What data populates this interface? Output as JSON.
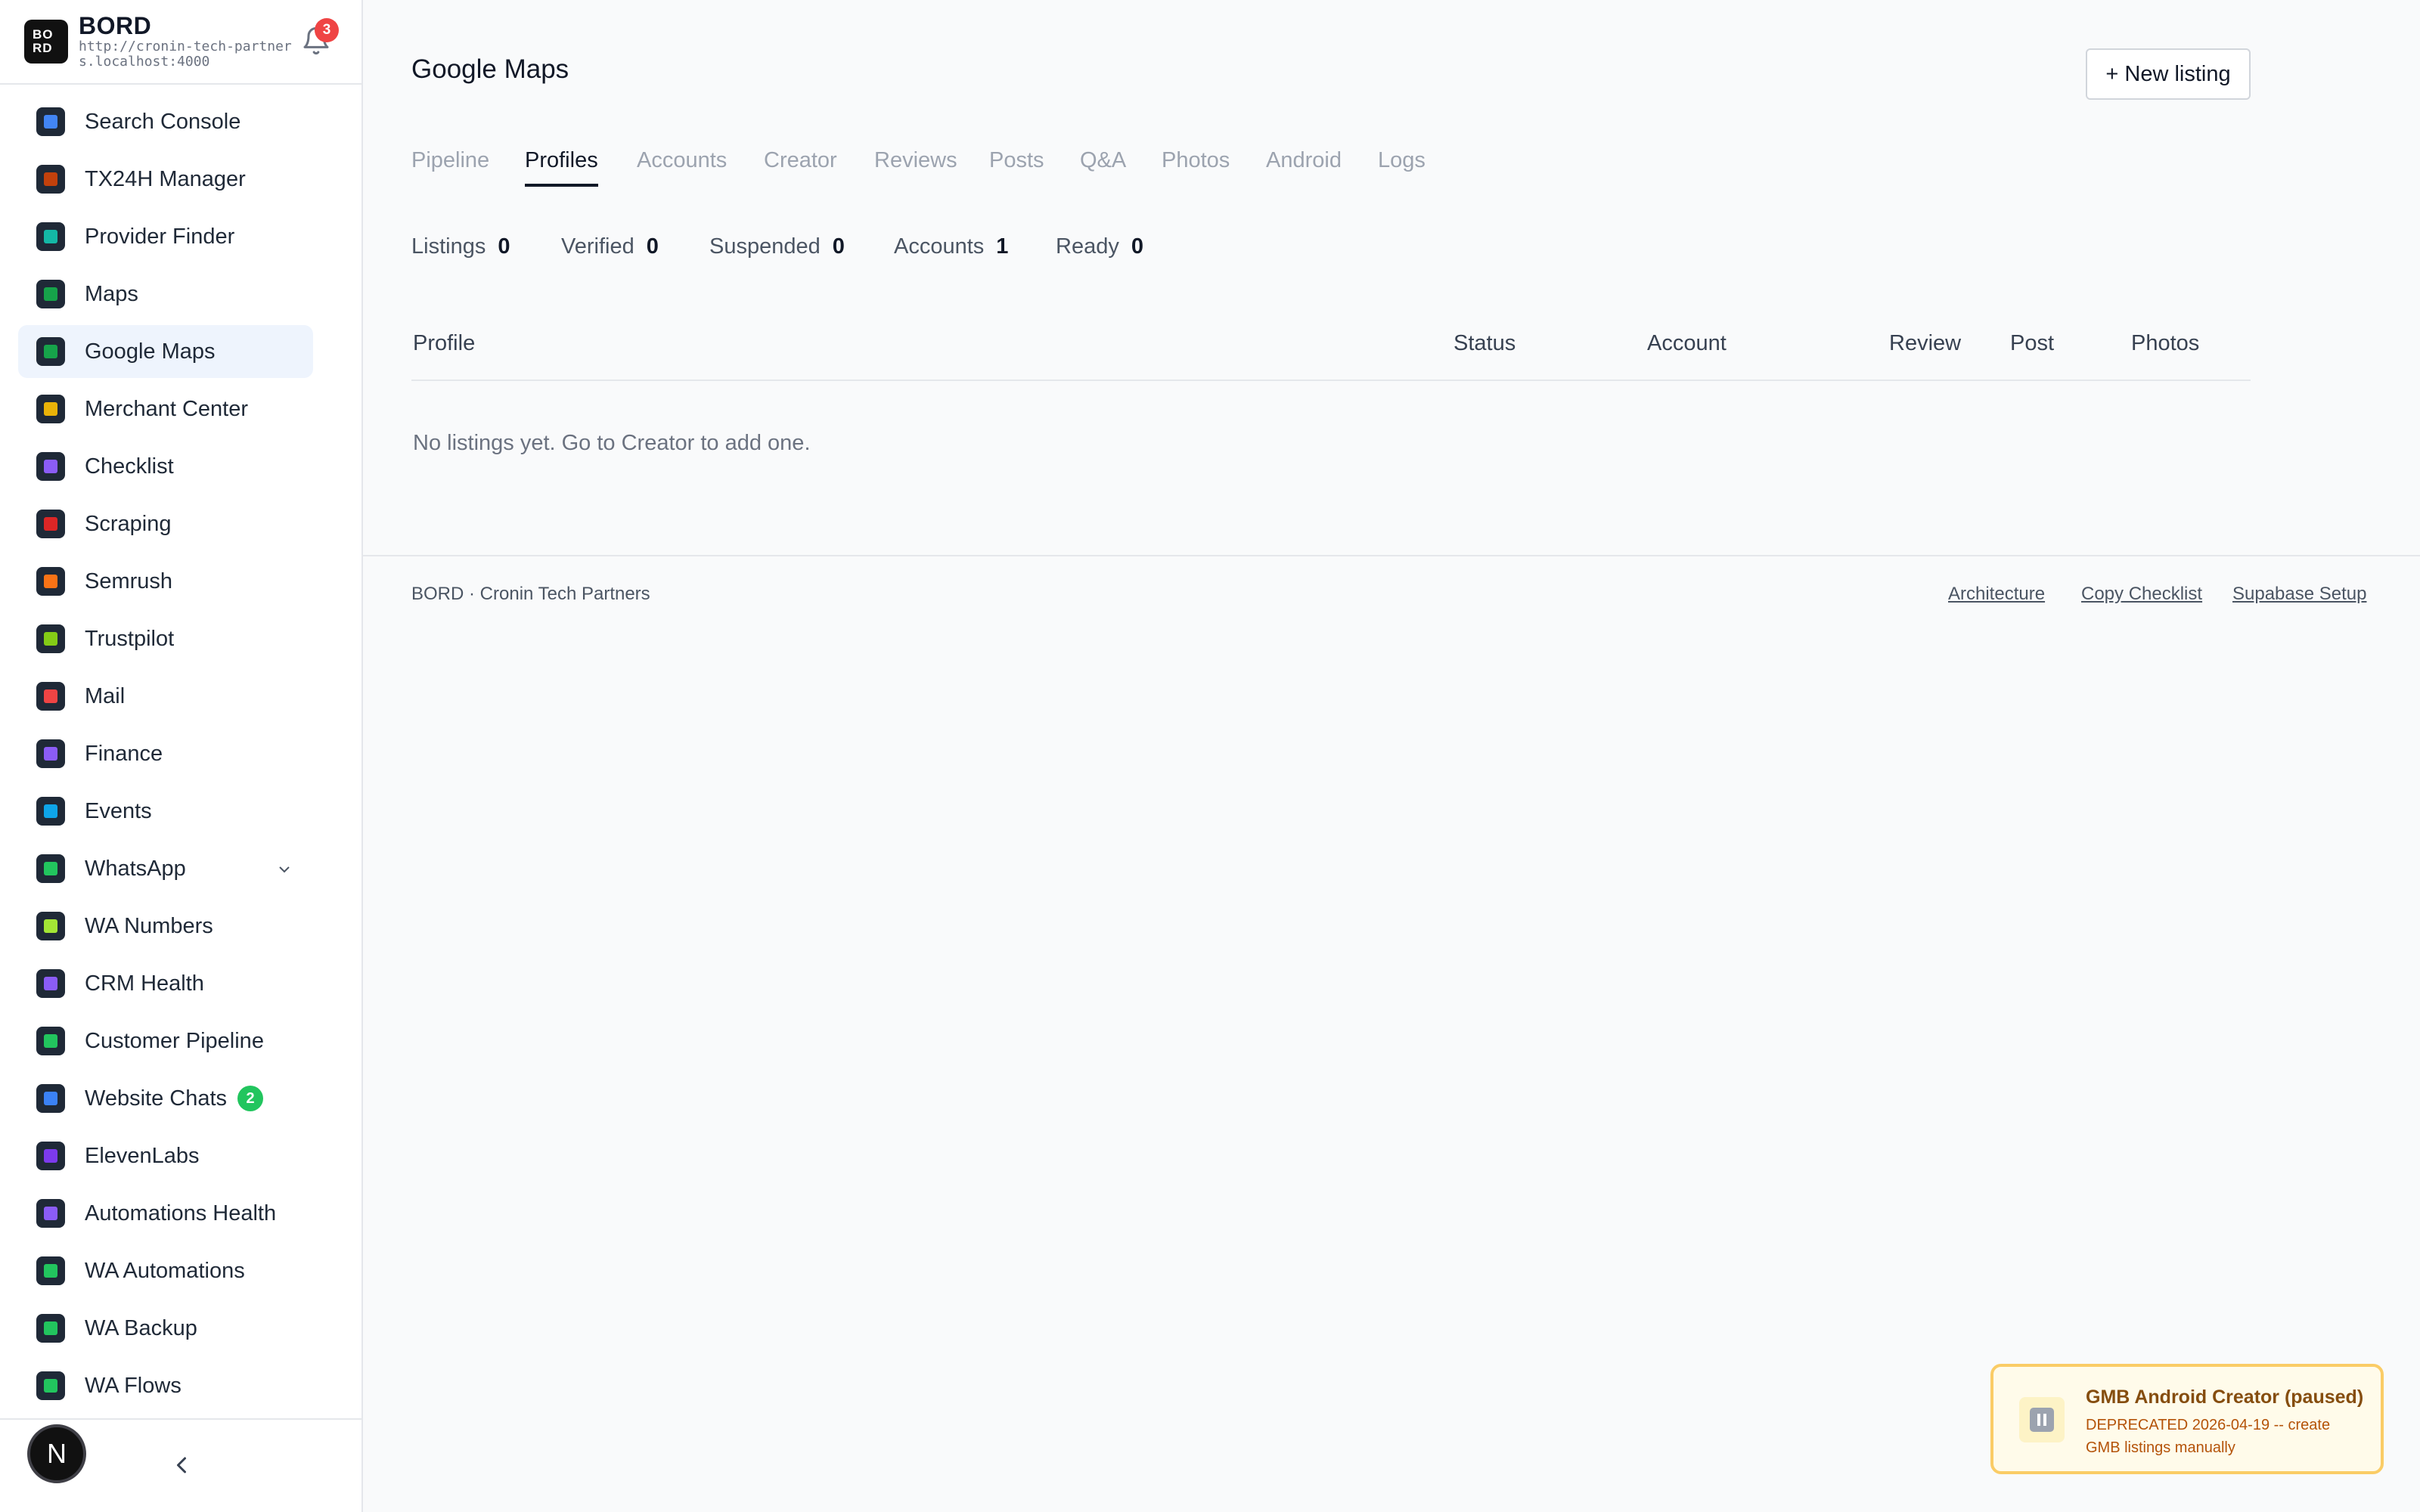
{
  "brand": {
    "logo_text": "BO RD",
    "name": "BORD",
    "url": "http://cronin-tech-partners.localhost:4000",
    "notification_count": "3"
  },
  "sidebar": {
    "items": [
      {
        "label": "Search Console",
        "icon": "search-console-icon",
        "color": "#4285f4"
      },
      {
        "label": "TX24H Manager",
        "icon": "tx24h-icon",
        "color": "#c2410c"
      },
      {
        "label": "Provider Finder",
        "icon": "provider-finder-icon",
        "color": "#14b8a6"
      },
      {
        "label": "Maps",
        "icon": "maps-icon",
        "color": "#16a34a"
      },
      {
        "label": "Google Maps",
        "icon": "google-maps-icon",
        "color": "#16a34a",
        "active": true
      },
      {
        "label": "Merchant Center",
        "icon": "merchant-center-icon",
        "color": "#eab308"
      },
      {
        "label": "Checklist",
        "icon": "checklist-icon",
        "color": "#8b5cf6"
      },
      {
        "label": "Scraping",
        "icon": "scraping-icon",
        "color": "#dc2626"
      },
      {
        "label": "Semrush",
        "icon": "semrush-icon",
        "color": "#f97316"
      },
      {
        "label": "Trustpilot",
        "icon": "trustpilot-icon",
        "color": "#84cc16"
      },
      {
        "label": "Mail",
        "icon": "mail-icon",
        "color": "#ef4444"
      },
      {
        "label": "Finance",
        "icon": "finance-icon",
        "color": "#8b5cf6"
      },
      {
        "label": "Events",
        "icon": "events-icon",
        "color": "#0ea5e9"
      },
      {
        "label": "WhatsApp",
        "icon": "whatsapp-icon",
        "color": "#22c55e",
        "expandable": true
      },
      {
        "label": "WA Numbers",
        "icon": "wa-numbers-icon",
        "color": "#a3e635"
      },
      {
        "label": "CRM Health",
        "icon": "crm-health-icon",
        "color": "#8b5cf6"
      },
      {
        "label": "Customer Pipeline",
        "icon": "customer-pipeline-icon",
        "color": "#22c55e"
      },
      {
        "label": "Website Chats",
        "icon": "website-chats-icon",
        "color": "#3b82f6",
        "badge": "2"
      },
      {
        "label": "ElevenLabs",
        "icon": "elevenlabs-icon",
        "color": "#7c3aed"
      },
      {
        "label": "Automations Health",
        "icon": "automations-health-icon",
        "color": "#8b5cf6"
      },
      {
        "label": "WA Automations",
        "icon": "wa-automations-icon",
        "color": "#22c55e"
      },
      {
        "label": "WA Backup",
        "icon": "wa-backup-icon",
        "color": "#22c55e"
      },
      {
        "label": "WA Flows",
        "icon": "wa-flows-icon",
        "color": "#22c55e"
      }
    ],
    "avatar_initial": "N"
  },
  "main": {
    "title": "Google Maps",
    "new_listing_label": "+ New listing",
    "tabs": [
      "Pipeline",
      "Profiles",
      "Accounts",
      "Creator",
      "Reviews",
      "Posts",
      "Q&A",
      "Photos",
      "Android",
      "Logs"
    ],
    "active_tab": "Profiles",
    "stats": [
      {
        "label": "Listings",
        "value": "0"
      },
      {
        "label": "Verified",
        "value": "0"
      },
      {
        "label": "Suspended",
        "value": "0"
      },
      {
        "label": "Accounts",
        "value": "1"
      },
      {
        "label": "Ready",
        "value": "0"
      }
    ],
    "table": {
      "columns": [
        "Profile",
        "Status",
        "Account",
        "Review",
        "Post",
        "Photos"
      ],
      "empty_message": "No listings yet. Go to Creator to add one."
    }
  },
  "footer": {
    "left": "BORD · Cronin Tech Partners",
    "links": [
      "Architecture",
      "Copy Checklist",
      "Supabase Setup"
    ]
  },
  "toast": {
    "title": "GMB Android Creator (paused)",
    "body": "DEPRECATED 2026-04-19 -- create GMB listings manually",
    "icon": "pause-icon"
  },
  "colors": {
    "accent": "#111827",
    "active_nav_bg": "#eef4fd",
    "notification": "#ef4444",
    "toast_border": "#facc66"
  }
}
